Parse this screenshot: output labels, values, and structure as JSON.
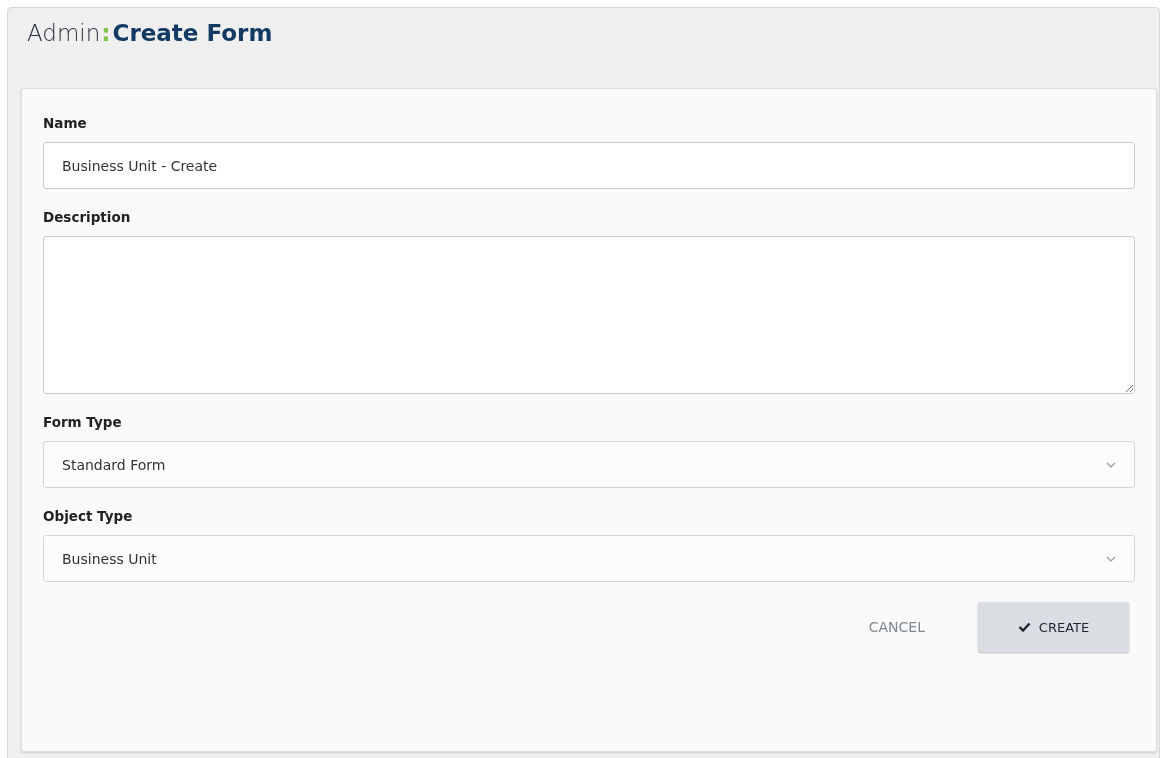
{
  "header": {
    "section": "Admin",
    "separator": ":",
    "title": "Create Form"
  },
  "fields": [
    {
      "kind": "text",
      "label": "Name",
      "value": "Business Unit - Create"
    },
    {
      "kind": "textarea",
      "label": "Description"
    },
    {
      "kind": "select",
      "label": "Form Type",
      "value": "Standard Form"
    },
    {
      "kind": "select",
      "label": "Object Type",
      "value": "Business Unit"
    }
  ],
  "buttons": [
    {
      "kind": "flat",
      "label": "CANCEL"
    },
    {
      "kind": "primary",
      "label": "CREATE"
    }
  ]
}
